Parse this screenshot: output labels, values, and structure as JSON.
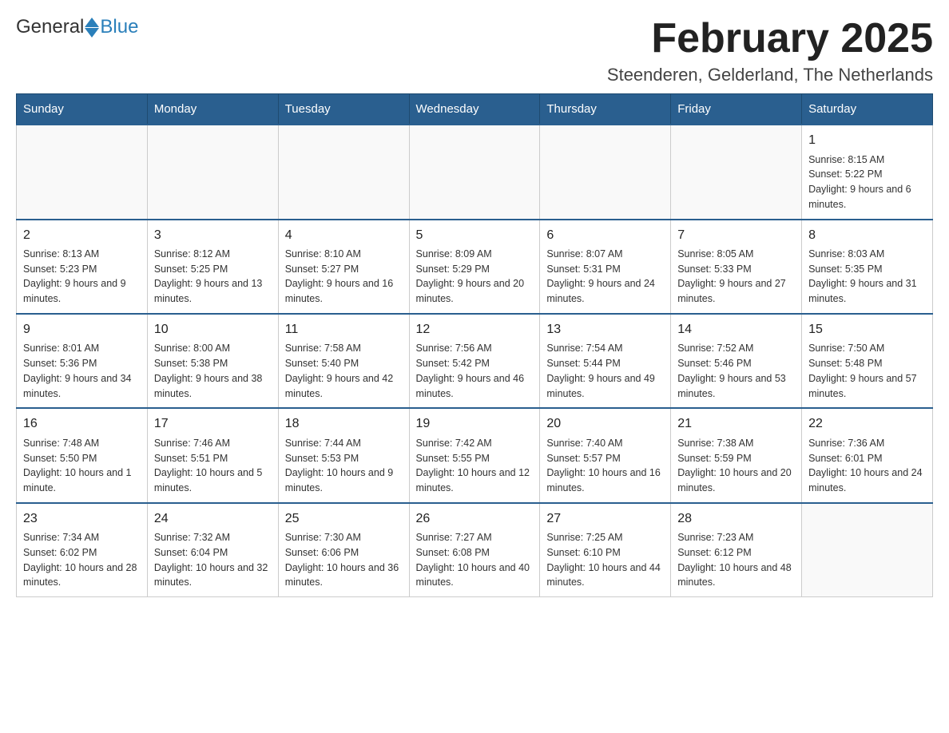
{
  "logo": {
    "general": "General",
    "blue": "Blue"
  },
  "header": {
    "month_title": "February 2025",
    "subtitle": "Steenderen, Gelderland, The Netherlands"
  },
  "weekdays": [
    "Sunday",
    "Monday",
    "Tuesday",
    "Wednesday",
    "Thursday",
    "Friday",
    "Saturday"
  ],
  "weeks": [
    {
      "days": [
        {
          "num": "",
          "info": ""
        },
        {
          "num": "",
          "info": ""
        },
        {
          "num": "",
          "info": ""
        },
        {
          "num": "",
          "info": ""
        },
        {
          "num": "",
          "info": ""
        },
        {
          "num": "",
          "info": ""
        },
        {
          "num": "1",
          "info": "Sunrise: 8:15 AM\nSunset: 5:22 PM\nDaylight: 9 hours and 6 minutes."
        }
      ]
    },
    {
      "days": [
        {
          "num": "2",
          "info": "Sunrise: 8:13 AM\nSunset: 5:23 PM\nDaylight: 9 hours and 9 minutes."
        },
        {
          "num": "3",
          "info": "Sunrise: 8:12 AM\nSunset: 5:25 PM\nDaylight: 9 hours and 13 minutes."
        },
        {
          "num": "4",
          "info": "Sunrise: 8:10 AM\nSunset: 5:27 PM\nDaylight: 9 hours and 16 minutes."
        },
        {
          "num": "5",
          "info": "Sunrise: 8:09 AM\nSunset: 5:29 PM\nDaylight: 9 hours and 20 minutes."
        },
        {
          "num": "6",
          "info": "Sunrise: 8:07 AM\nSunset: 5:31 PM\nDaylight: 9 hours and 24 minutes."
        },
        {
          "num": "7",
          "info": "Sunrise: 8:05 AM\nSunset: 5:33 PM\nDaylight: 9 hours and 27 minutes."
        },
        {
          "num": "8",
          "info": "Sunrise: 8:03 AM\nSunset: 5:35 PM\nDaylight: 9 hours and 31 minutes."
        }
      ]
    },
    {
      "days": [
        {
          "num": "9",
          "info": "Sunrise: 8:01 AM\nSunset: 5:36 PM\nDaylight: 9 hours and 34 minutes."
        },
        {
          "num": "10",
          "info": "Sunrise: 8:00 AM\nSunset: 5:38 PM\nDaylight: 9 hours and 38 minutes."
        },
        {
          "num": "11",
          "info": "Sunrise: 7:58 AM\nSunset: 5:40 PM\nDaylight: 9 hours and 42 minutes."
        },
        {
          "num": "12",
          "info": "Sunrise: 7:56 AM\nSunset: 5:42 PM\nDaylight: 9 hours and 46 minutes."
        },
        {
          "num": "13",
          "info": "Sunrise: 7:54 AM\nSunset: 5:44 PM\nDaylight: 9 hours and 49 minutes."
        },
        {
          "num": "14",
          "info": "Sunrise: 7:52 AM\nSunset: 5:46 PM\nDaylight: 9 hours and 53 minutes."
        },
        {
          "num": "15",
          "info": "Sunrise: 7:50 AM\nSunset: 5:48 PM\nDaylight: 9 hours and 57 minutes."
        }
      ]
    },
    {
      "days": [
        {
          "num": "16",
          "info": "Sunrise: 7:48 AM\nSunset: 5:50 PM\nDaylight: 10 hours and 1 minute."
        },
        {
          "num": "17",
          "info": "Sunrise: 7:46 AM\nSunset: 5:51 PM\nDaylight: 10 hours and 5 minutes."
        },
        {
          "num": "18",
          "info": "Sunrise: 7:44 AM\nSunset: 5:53 PM\nDaylight: 10 hours and 9 minutes."
        },
        {
          "num": "19",
          "info": "Sunrise: 7:42 AM\nSunset: 5:55 PM\nDaylight: 10 hours and 12 minutes."
        },
        {
          "num": "20",
          "info": "Sunrise: 7:40 AM\nSunset: 5:57 PM\nDaylight: 10 hours and 16 minutes."
        },
        {
          "num": "21",
          "info": "Sunrise: 7:38 AM\nSunset: 5:59 PM\nDaylight: 10 hours and 20 minutes."
        },
        {
          "num": "22",
          "info": "Sunrise: 7:36 AM\nSunset: 6:01 PM\nDaylight: 10 hours and 24 minutes."
        }
      ]
    },
    {
      "days": [
        {
          "num": "23",
          "info": "Sunrise: 7:34 AM\nSunset: 6:02 PM\nDaylight: 10 hours and 28 minutes."
        },
        {
          "num": "24",
          "info": "Sunrise: 7:32 AM\nSunset: 6:04 PM\nDaylight: 10 hours and 32 minutes."
        },
        {
          "num": "25",
          "info": "Sunrise: 7:30 AM\nSunset: 6:06 PM\nDaylight: 10 hours and 36 minutes."
        },
        {
          "num": "26",
          "info": "Sunrise: 7:27 AM\nSunset: 6:08 PM\nDaylight: 10 hours and 40 minutes."
        },
        {
          "num": "27",
          "info": "Sunrise: 7:25 AM\nSunset: 6:10 PM\nDaylight: 10 hours and 44 minutes."
        },
        {
          "num": "28",
          "info": "Sunrise: 7:23 AM\nSunset: 6:12 PM\nDaylight: 10 hours and 48 minutes."
        },
        {
          "num": "",
          "info": ""
        }
      ]
    }
  ]
}
